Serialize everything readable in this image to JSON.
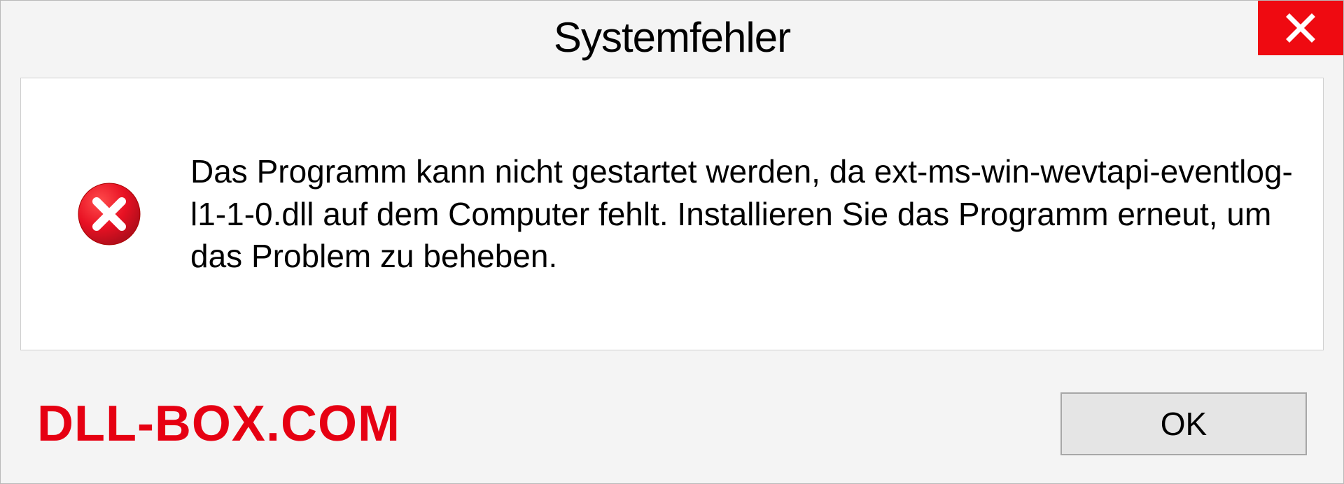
{
  "dialog": {
    "title": "Systemfehler",
    "message": "Das Programm kann nicht gestartet werden, da ext-ms-win-wevtapi-eventlog-l1-1-0.dll auf dem Computer fehlt. Installieren Sie das Programm erneut, um das Problem zu beheben.",
    "ok_label": "OK"
  },
  "watermark": "DLL-BOX.COM",
  "colors": {
    "close_bg": "#ef0a11",
    "error_icon": "#e81123",
    "watermark": "#e60012"
  }
}
